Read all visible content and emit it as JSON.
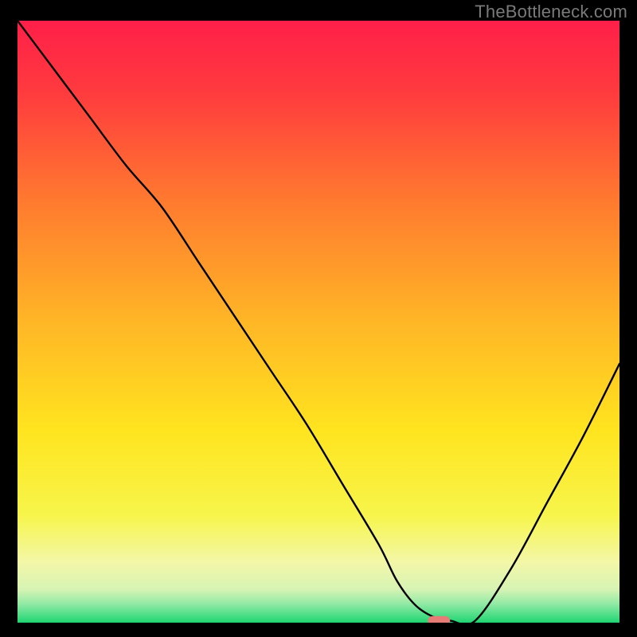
{
  "watermark": "TheBottleneck.com",
  "chart_data": {
    "type": "line",
    "title": "",
    "xlabel": "",
    "ylabel": "",
    "xlim": [
      0,
      100
    ],
    "ylim": [
      0,
      100
    ],
    "grid": false,
    "legend": false,
    "series": [
      {
        "name": "bottleneck-curve",
        "x": [
          0,
          6,
          12,
          18,
          24,
          30,
          36,
          42,
          48,
          54,
          60,
          63,
          66,
          69,
          72,
          76,
          82,
          88,
          94,
          100
        ],
        "y": [
          100,
          92,
          84,
          76,
          69,
          60,
          51,
          42,
          33,
          23,
          13,
          7,
          3,
          1,
          0.3,
          0.3,
          9,
          20,
          31,
          43
        ]
      }
    ],
    "marker": {
      "name": "optimal-point",
      "x": 70,
      "y": 0.3,
      "color": "#e77b76"
    },
    "background_gradient": {
      "stops": [
        {
          "offset": 0.0,
          "color": "#ff1f49"
        },
        {
          "offset": 0.12,
          "color": "#ff3b3e"
        },
        {
          "offset": 0.3,
          "color": "#ff7a2f"
        },
        {
          "offset": 0.5,
          "color": "#ffb626"
        },
        {
          "offset": 0.68,
          "color": "#ffe41f"
        },
        {
          "offset": 0.82,
          "color": "#f7f54a"
        },
        {
          "offset": 0.9,
          "color": "#f3f7a8"
        },
        {
          "offset": 0.945,
          "color": "#d6f3b4"
        },
        {
          "offset": 0.97,
          "color": "#8de9a3"
        },
        {
          "offset": 1.0,
          "color": "#1fd572"
        }
      ]
    }
  }
}
